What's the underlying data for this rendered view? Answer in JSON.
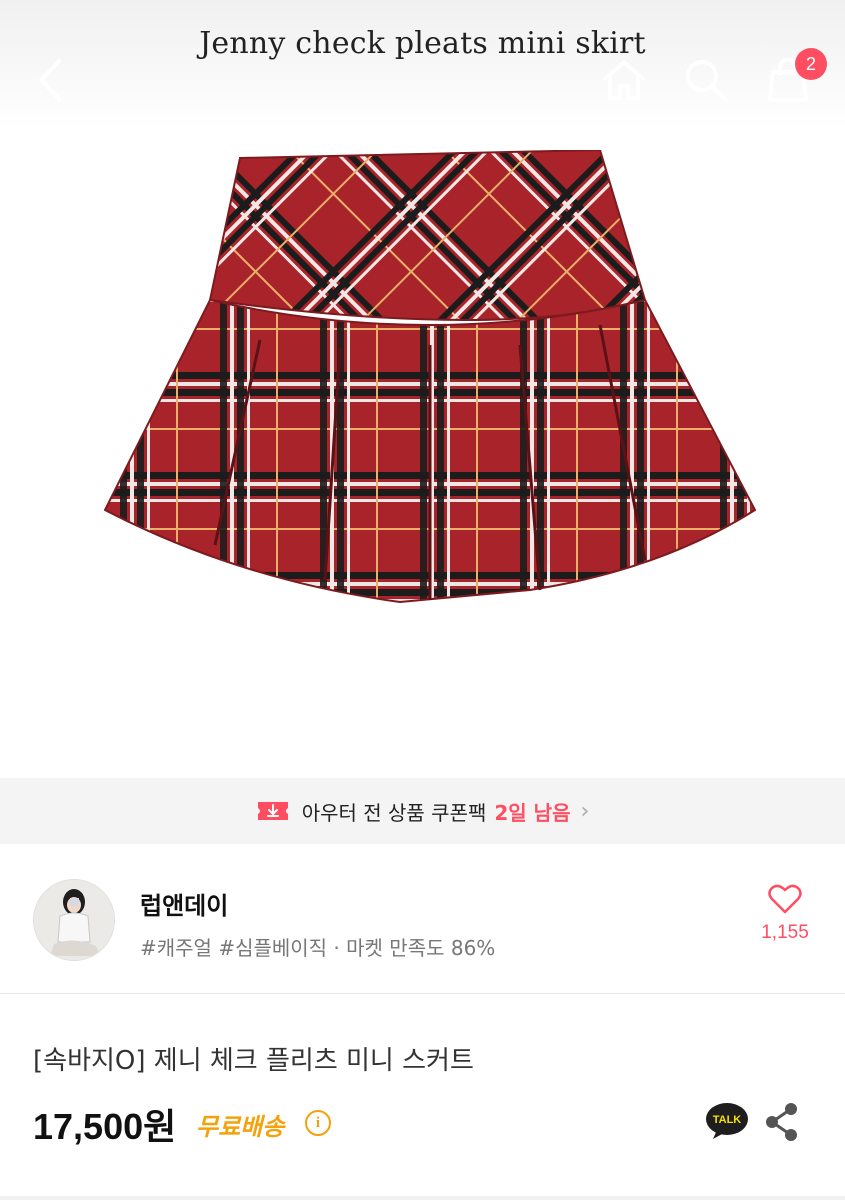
{
  "header": {
    "image_caption": "Jenny check pleats mini skirt",
    "cart_count": "2"
  },
  "icons": {
    "back": "chevron-left-icon",
    "home": "home-icon",
    "search": "search-icon",
    "cart": "shopping-bag-icon"
  },
  "coupon": {
    "text": "아우터 전 상품 쿠폰팩",
    "highlight": "2일 남음",
    "chevron": "›"
  },
  "shop": {
    "name": "럽앤데이",
    "tags": "#캐주얼 #심플베이직 · 마켓 만족도 86%",
    "like_count": "1,155"
  },
  "product": {
    "title": "[속바지O] 제니 체크 플리츠 미니 스커트",
    "price": "17,500원",
    "shipping": "무료배송",
    "talk_label": "TALK"
  },
  "colors": {
    "accent": "#ff4e62",
    "shipping": "#f4a20c",
    "skirt_base": "#a8242a"
  }
}
